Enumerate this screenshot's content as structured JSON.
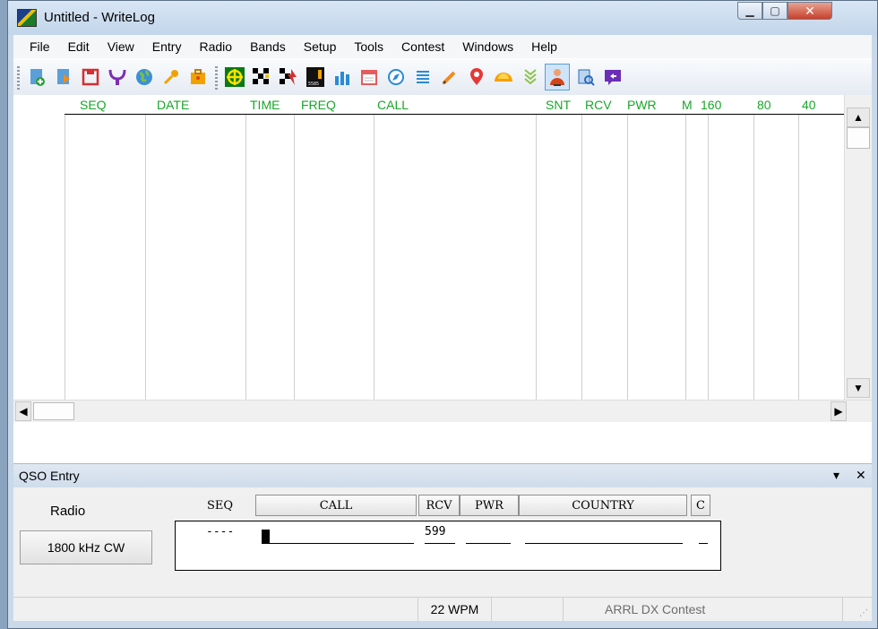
{
  "window": {
    "title": "Untitled - WriteLog"
  },
  "menu": [
    "File",
    "Edit",
    "View",
    "Entry",
    "Radio",
    "Bands",
    "Setup",
    "Tools",
    "Contest",
    "Windows",
    "Help"
  ],
  "log": {
    "columns": [
      "SEQ",
      "DATE",
      "TIME",
      "FREQ",
      "CALL",
      "SNT",
      "RCV",
      "PWR",
      "M",
      "160",
      "80",
      "40"
    ]
  },
  "qso_entry": {
    "title": "QSO Entry",
    "radio_label": "Radio",
    "frequency_button": "1800 kHz CW",
    "field_labels": {
      "seq": "SEQ",
      "call": "CALL",
      "rcv": "RCV",
      "pwr": "PWR",
      "country": "COUNTRY",
      "c": "C"
    },
    "values": {
      "seq": "----",
      "rcv": "599"
    }
  },
  "status": {
    "wpm": "22 WPM",
    "contest": "ARRL DX Contest"
  },
  "colors": {
    "header_text": "#1aa52a",
    "background": "#f0f0f0"
  }
}
